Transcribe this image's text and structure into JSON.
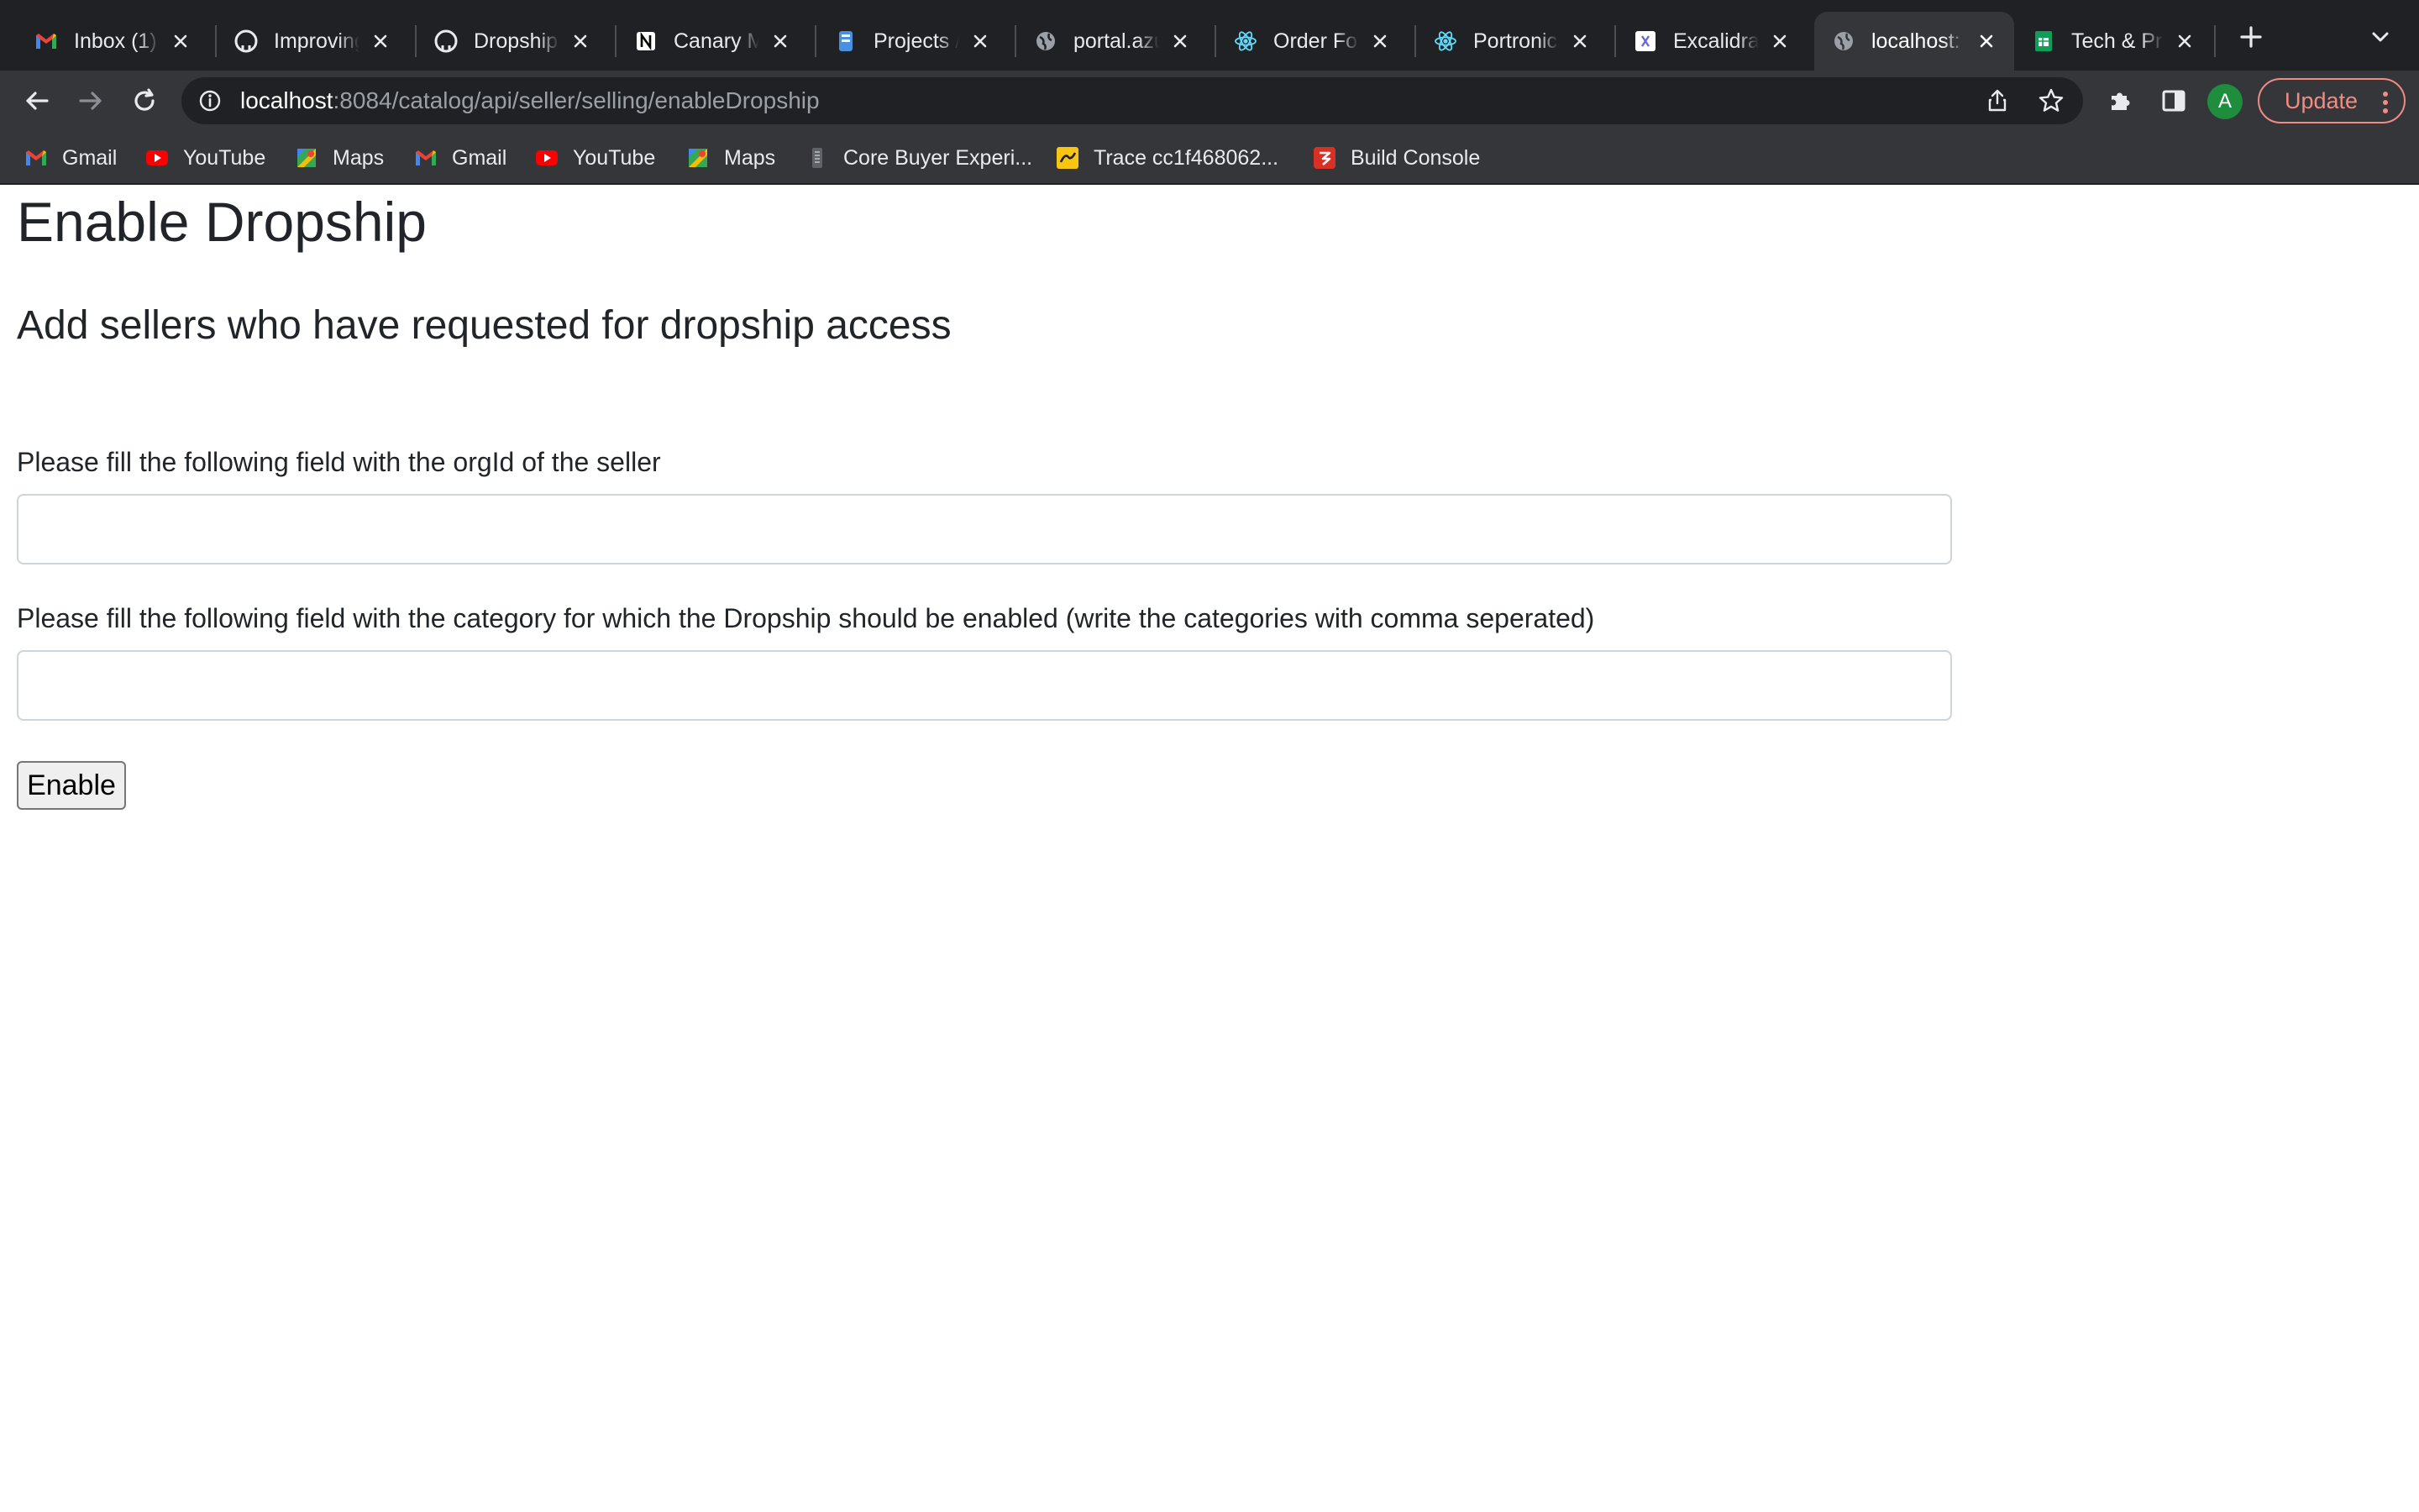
{
  "browser": {
    "tabs": [
      {
        "title": "Inbox (1) - ",
        "icon": "gmail-icon",
        "active": false
      },
      {
        "title": "Improving",
        "icon": "github-icon",
        "active": false
      },
      {
        "title": "Dropship",
        "icon": "github-icon",
        "active": false
      },
      {
        "title": "Canary M",
        "icon": "notion-icon",
        "active": false
      },
      {
        "title": "Projects /",
        "icon": "jira-icon",
        "active": false
      },
      {
        "title": "portal.azu",
        "icon": "globe-icon",
        "active": false
      },
      {
        "title": "Order For",
        "icon": "react-icon",
        "active": false
      },
      {
        "title": "Portronics",
        "icon": "react-icon",
        "active": false
      },
      {
        "title": "Excalidraw",
        "icon": "excalidraw-icon",
        "active": false
      },
      {
        "title": "localhost:",
        "icon": "globe-icon",
        "active": true
      },
      {
        "title": "Tech & Pr",
        "icon": "sheets-icon",
        "active": false
      }
    ],
    "url_host": "localhost",
    "url_path": ":8084/catalog/api/seller/selling/enableDropship",
    "profile_initial": "A",
    "update_label": "Update",
    "bookmarks": [
      {
        "label": "Gmail",
        "icon": "gmail-icon"
      },
      {
        "label": "YouTube",
        "icon": "youtube-icon"
      },
      {
        "label": "Maps",
        "icon": "maps-icon"
      },
      {
        "label": "Gmail",
        "icon": "gmail-icon"
      },
      {
        "label": "YouTube",
        "icon": "youtube-icon"
      },
      {
        "label": "Maps",
        "icon": "maps-icon"
      },
      {
        "label": "Core Buyer Experi...",
        "icon": "document-icon"
      },
      {
        "label": "Trace cc1f468062...",
        "icon": "trace-icon"
      },
      {
        "label": "Build Console",
        "icon": "build-icon"
      }
    ]
  },
  "page": {
    "title": "Enable Dropship",
    "subtitle": "Add sellers who have requested for dropship access",
    "org_field": {
      "label": "Please fill the following field with the orgId of the seller",
      "value": "",
      "placeholder": ""
    },
    "category_field": {
      "label": "Please fill the following field with the category for which the Dropship should be enabled (write the categories with comma seperated)",
      "value": "",
      "placeholder": ""
    },
    "submit_label": "Enable"
  },
  "colors": {
    "tabstrip_bg": "#202124",
    "toolbar_bg": "#35363a",
    "update_accent": "#f28b82",
    "avatar_bg": "#1e8e3e",
    "text_dark": "#212529",
    "input_border": "#ced4da"
  }
}
